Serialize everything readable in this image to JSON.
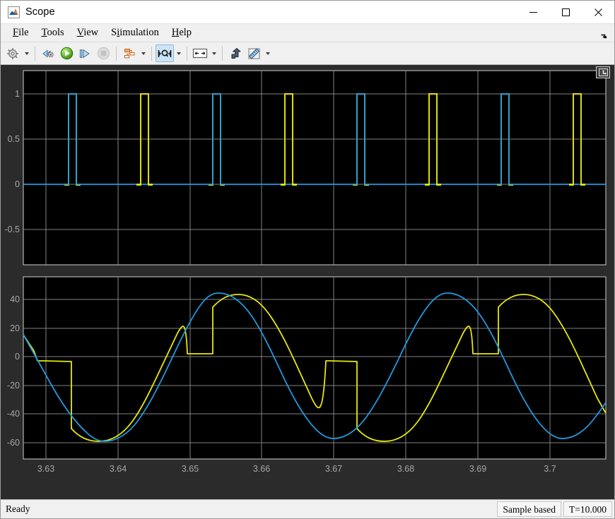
{
  "window": {
    "title": "Scope",
    "app_icon": "matlab-scope-icon",
    "controls": {
      "minimize": "minimize",
      "maximize": "maximize",
      "close": "close"
    }
  },
  "menubar": {
    "items": [
      {
        "label": "File",
        "mnemonic": "F"
      },
      {
        "label": "Tools",
        "mnemonic": "T"
      },
      {
        "label": "View",
        "mnemonic": "V"
      },
      {
        "label": "Simulation",
        "mnemonic": "S"
      },
      {
        "label": "Help",
        "mnemonic": "H"
      }
    ],
    "expand_icon": "expand-arrow-icon"
  },
  "toolbar": {
    "buttons": [
      {
        "name": "configuration-properties",
        "icon": "gear-icon",
        "tooltip": "Configuration Properties",
        "has_dropdown": true,
        "state": "normal"
      },
      {
        "name": "simulink-model",
        "icon": "rewind-icon",
        "tooltip": "Simulink Model",
        "has_dropdown": false,
        "state": "normal"
      },
      {
        "name": "run-button",
        "icon": "play-icon",
        "tooltip": "Run",
        "has_dropdown": false,
        "state": "normal"
      },
      {
        "name": "step-forward-button",
        "icon": "step-forward-icon",
        "tooltip": "Step Forward",
        "has_dropdown": false,
        "state": "normal"
      },
      {
        "name": "stop-button",
        "icon": "stop-icon",
        "tooltip": "Stop",
        "has_dropdown": false,
        "state": "disabled"
      },
      {
        "name": "signal-selection",
        "icon": "signal-hierarchy-icon",
        "tooltip": "Signal Selection",
        "has_dropdown": true,
        "state": "normal"
      },
      {
        "name": "zoom-in-x",
        "icon": "zoom-x-icon",
        "tooltip": "Zoom In X",
        "has_dropdown": true,
        "state": "active"
      },
      {
        "name": "autoscale-button",
        "icon": "fit-to-view-icon",
        "tooltip": "Autoscale",
        "has_dropdown": true,
        "state": "normal"
      },
      {
        "name": "highlight-signal",
        "icon": "highlight-arrow-icon",
        "tooltip": "Highlight Signal in Model",
        "has_dropdown": false,
        "state": "normal"
      },
      {
        "name": "measurements-button",
        "icon": "ruler-icon",
        "tooltip": "Measurements",
        "has_dropdown": true,
        "state": "normal"
      }
    ]
  },
  "plot_panel": {
    "float_button_icon": "float-panel-icon",
    "background": "#000000",
    "panel_background": "#2b2b2b",
    "grid_color": "#828282",
    "axis_label_color": "#a6a6a6"
  },
  "statusbar": {
    "message": "Ready",
    "frame_mode": "Sample based",
    "time": "T=10.000"
  },
  "chart_data": [
    {
      "id": "upper-plot",
      "type": "line",
      "title": "",
      "xlabel": "",
      "ylabel": "",
      "xlim": [
        3.6265,
        3.7075
      ],
      "ylim": [
        -0.83,
        1.32
      ],
      "xticks": [
        3.63,
        3.64,
        3.65,
        3.66,
        3.67,
        3.68,
        3.69,
        3.7
      ],
      "xticklabels": [
        "3.63",
        "3.64",
        "3.65",
        "3.66",
        "3.67",
        "3.68",
        "3.69",
        "3.7"
      ],
      "yticks": [
        1,
        0.5,
        0,
        -0.5
      ],
      "yticklabels": [
        "1",
        "0.5",
        "0",
        "-0.5"
      ],
      "grid": true,
      "colors": {
        "series1": "#1f9ae0",
        "series2": "#e8e80c"
      },
      "series": [
        {
          "name": "pulse-blue",
          "color": "#1f9ae0",
          "description": "Narrow unit pulses, width 0.0010, baseline 0 held across full span",
          "baseline": 0,
          "pulse_width": 0.001,
          "pulse_height": 1,
          "pulse_starts": [
            3.6325,
            3.6525,
            3.6725,
            3.6925
          ]
        },
        {
          "name": "pulse-yellow",
          "color": "#e8e80c",
          "description": "Narrow unit pulses interleaved between the blue pulses",
          "baseline": 0,
          "pulse_width": 0.001,
          "pulse_height": 1,
          "pulse_starts": [
            3.6425,
            3.6625,
            3.6825,
            3.7025
          ]
        }
      ]
    },
    {
      "id": "lower-plot",
      "type": "line",
      "title": "",
      "xlabel": "",
      "ylabel": "",
      "xlim": [
        3.6265,
        3.7075
      ],
      "ylim": [
        -71,
        56
      ],
      "xticks": [
        3.63,
        3.64,
        3.65,
        3.66,
        3.67,
        3.68,
        3.69,
        3.7
      ],
      "xticklabels": [
        "3.63",
        "3.64",
        "3.65",
        "3.66",
        "3.67",
        "3.68",
        "3.69",
        "3.7"
      ],
      "yticks": [
        40,
        20,
        0,
        -20,
        -40,
        -60
      ],
      "yticklabels": [
        "40",
        "20",
        "0",
        "-20",
        "-40",
        "-60"
      ],
      "grid": true,
      "colors": {
        "series1": "#1f9ae0",
        "series2": "#e8e80c"
      },
      "series": [
        {
          "name": "sine-reference",
          "color": "#1f9ae0",
          "description": "Sine wave, amplitude 50, period 0.02 s",
          "waveform": "sine",
          "amplitude": 50,
          "period": 0.02,
          "phase_zero_crossing_rising": 3.6575,
          "offset": 0
        },
        {
          "name": "sample-hold-output",
          "color": "#e8e80c",
          "description": "Tracks the sine near peaks and troughs, then holds a small near-zero plateau before stepping back onto the sine",
          "waveform": "track-and-hold",
          "amplitude": 50,
          "period": 0.02,
          "hold_level_positive": 3,
          "hold_level_negative": -3,
          "segments": [
            {
              "hold_start": 3.6295,
              "hold_end": 3.6355,
              "level": -3,
              "step_to": -48
            },
            {
              "hold_start": 3.654,
              "hold_end": 3.665,
              "level": 3,
              "step_to": 47
            },
            {
              "hold_start": 3.6695,
              "hold_end": 3.6755,
              "level": -3,
              "step_to": -48
            },
            {
              "hold_start": 3.694,
              "hold_end": 3.705,
              "level": 3,
              "step_to": 47
            }
          ]
        }
      ]
    }
  ]
}
